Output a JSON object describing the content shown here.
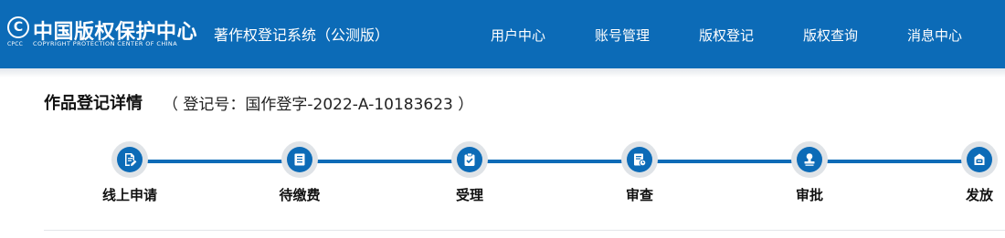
{
  "header": {
    "logo_mark": "C",
    "logo_abbr": "CPCC",
    "logo_cn": "中国版权保护中心",
    "logo_en": "COPYRIGHT PROTECTION CENTER OF CHINA",
    "system_title": "著作权登记系统（公测版）",
    "nav": [
      "用户中心",
      "账号管理",
      "版权登记",
      "版权查询",
      "消息中心"
    ]
  },
  "page": {
    "title": "作品登记详情",
    "registration_number": "（ 登记号：国作登字-2022-A-10183623 ）"
  },
  "steps": [
    {
      "label": "线上申请",
      "icon": "edit-document-icon"
    },
    {
      "label": "待缴费",
      "icon": "payment-document-icon"
    },
    {
      "label": "受理",
      "icon": "clipboard-check-icon"
    },
    {
      "label": "审查",
      "icon": "document-clock-icon"
    },
    {
      "label": "审批",
      "icon": "stamp-icon"
    },
    {
      "label": "发放",
      "icon": "certificate-box-icon"
    }
  ],
  "colors": {
    "primary": "#0c6bb7",
    "step_ring": "#dfe3e7",
    "text": "#111111"
  }
}
